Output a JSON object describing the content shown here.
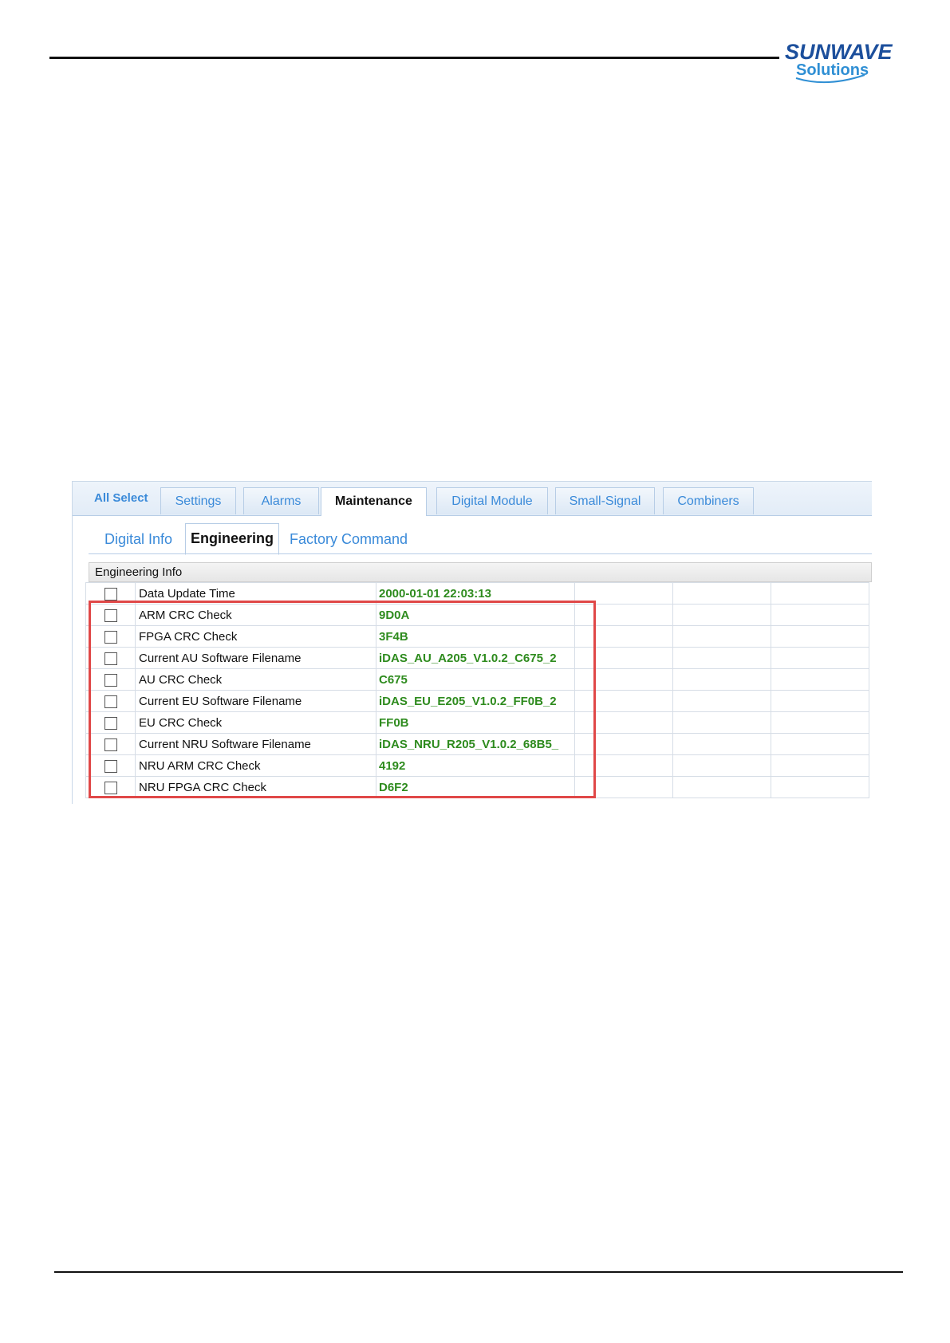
{
  "logo": {
    "brand_line1": "SUNWAVE",
    "brand_line2": "Solutions",
    "brand_color": "#1c4f9c",
    "accent_color": "#2f8fd4"
  },
  "main_tabs": {
    "all_select": "All Select",
    "items": [
      {
        "label": "Settings",
        "active": false
      },
      {
        "label": "Alarms",
        "active": false
      },
      {
        "label": "Maintenance",
        "active": true
      },
      {
        "label": "Digital Module",
        "active": false
      },
      {
        "label": "Small-Signal",
        "active": false
      },
      {
        "label": "Combiners",
        "active": false
      }
    ]
  },
  "sub_tabs": {
    "items": [
      {
        "label": "Digital Info",
        "active": false
      },
      {
        "label": "Engineering",
        "active": true
      },
      {
        "label": "Factory Command",
        "active": false
      }
    ]
  },
  "group": {
    "title": "Engineering Info"
  },
  "rows": [
    {
      "name": "Data Update Time",
      "value": "2000-01-01 22:03:13",
      "checked": false
    },
    {
      "name": "ARM CRC Check",
      "value": "9D0A",
      "checked": false
    },
    {
      "name": "FPGA CRC Check",
      "value": "3F4B",
      "checked": false
    },
    {
      "name": "Current AU Software Filename",
      "value": "iDAS_AU_A205_V1.0.2_C675_2",
      "checked": false
    },
    {
      "name": "AU CRC Check",
      "value": "C675",
      "checked": false
    },
    {
      "name": "Current EU Software Filename",
      "value": "iDAS_EU_E205_V1.0.2_FF0B_2",
      "checked": false
    },
    {
      "name": "EU CRC Check",
      "value": "FF0B",
      "checked": false
    },
    {
      "name": "Current NRU Software Filename",
      "value": "iDAS_NRU_R205_V1.0.2_68B5_",
      "checked": false
    },
    {
      "name": "NRU ARM CRC Check",
      "value": "4192",
      "checked": false
    },
    {
      "name": "NRU FPGA CRC Check",
      "value": "D6F2",
      "checked": false
    }
  ],
  "colors": {
    "tab_text": "#3a8ad9",
    "value_text": "#2e8b1e",
    "highlight": "#e04848"
  }
}
